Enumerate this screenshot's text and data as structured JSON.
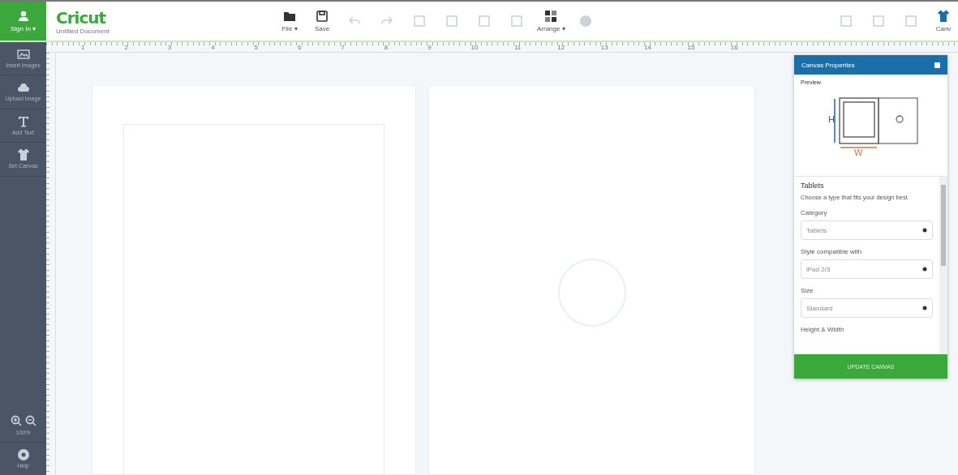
{
  "account": {
    "label": "Sign In ▾"
  },
  "header": {
    "logo": "Cricut",
    "document_title": "Untitled Document"
  },
  "toolbar": [
    {
      "kind": "folder",
      "label": "File ▾",
      "disabled": false
    },
    {
      "kind": "disk",
      "label": "Save",
      "disabled": false
    },
    {
      "kind": "undo",
      "disabled": true
    },
    {
      "kind": "redo",
      "disabled": true
    },
    {
      "kind": "square",
      "disabled": true
    },
    {
      "kind": "square",
      "disabled": true
    },
    {
      "kind": "square",
      "disabled": true
    },
    {
      "kind": "square",
      "disabled": true
    },
    {
      "kind": "arrange",
      "label": "Arrange ▾",
      "disabled": false
    },
    {
      "kind": "circle",
      "disabled": true
    }
  ],
  "right_tools": [
    {
      "kind": "square",
      "disabled": true
    },
    {
      "kind": "square",
      "disabled": true
    },
    {
      "kind": "square",
      "disabled": true
    },
    {
      "kind": "shirt",
      "label": "Canv",
      "disabled": false
    }
  ],
  "sidebar": [
    {
      "kind": "image",
      "label": "Insert Images"
    },
    {
      "kind": "cloud",
      "label": "Upload Image"
    },
    {
      "kind": "text",
      "label": "Add Text"
    },
    {
      "kind": "shirt",
      "label": "Set Canvas"
    }
  ],
  "zoom": {
    "value": "100%"
  },
  "help": {
    "label": "Help"
  },
  "ruler": [
    "1",
    "2",
    "3",
    "4",
    "5",
    "6",
    "7",
    "8",
    "9",
    "10",
    "11",
    "12",
    "13",
    "14",
    "15",
    "16"
  ],
  "panel": {
    "title": "Canvas Properties",
    "preview_label": "Preview",
    "height_mark": "H",
    "width_mark": "W",
    "section_title": "Tablets",
    "section_hint": "Choose a type that fits your design best",
    "fields": [
      {
        "label": "Category",
        "value": "Tablets"
      },
      {
        "label": "Style compatible with",
        "value": "iPad 2/3"
      },
      {
        "label": "Size",
        "value": "Standard"
      }
    ],
    "next_label": "Height & Width",
    "button": "UPDATE CANVAS"
  }
}
